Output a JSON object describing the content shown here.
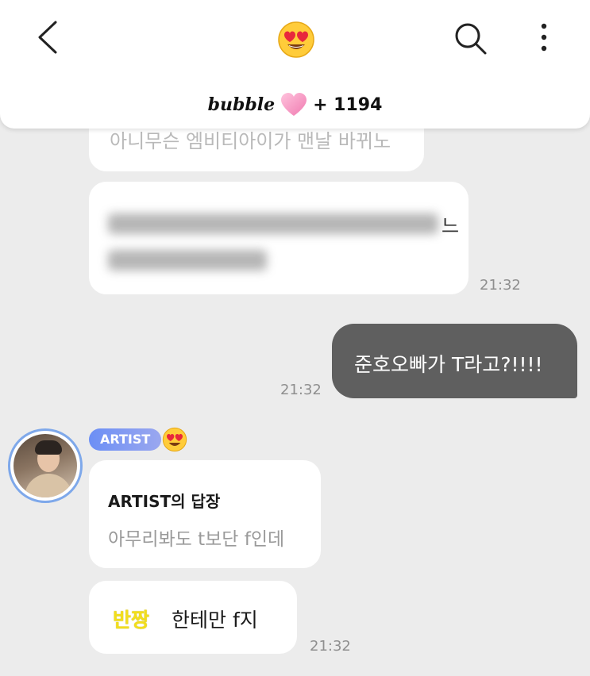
{
  "header": {
    "back": "back-icon",
    "title_emoji": "heart-eyes-emoji-icon",
    "search": "search-icon",
    "more": "more-vertical-icon",
    "brand": "bubble",
    "brand_icon": "pink-heart-icon",
    "count": "+ 1194"
  },
  "messages": {
    "faded": "아니무슨 엠비티아이가 맨날 바뀌노",
    "blurred_tail": "느",
    "blurred_time": "21:32",
    "sent": "준호오빠가 T라고?!!!!",
    "sent_time": "21:32",
    "artist_badge": "ARTIST",
    "badge_emoji": "heart-eyes-emoji-icon",
    "reply_title": "ARTIST의 답장",
    "reply_text": "아무리봐도 t보단 f인데",
    "highlight": "반짱",
    "last_text": "한테만 f지",
    "last_time": "21:32"
  },
  "colors": {
    "background": "#ececec",
    "sent_bubble": "#5f5f5f",
    "badge": "#6c8ff5",
    "highlight": "#f2de1c"
  }
}
